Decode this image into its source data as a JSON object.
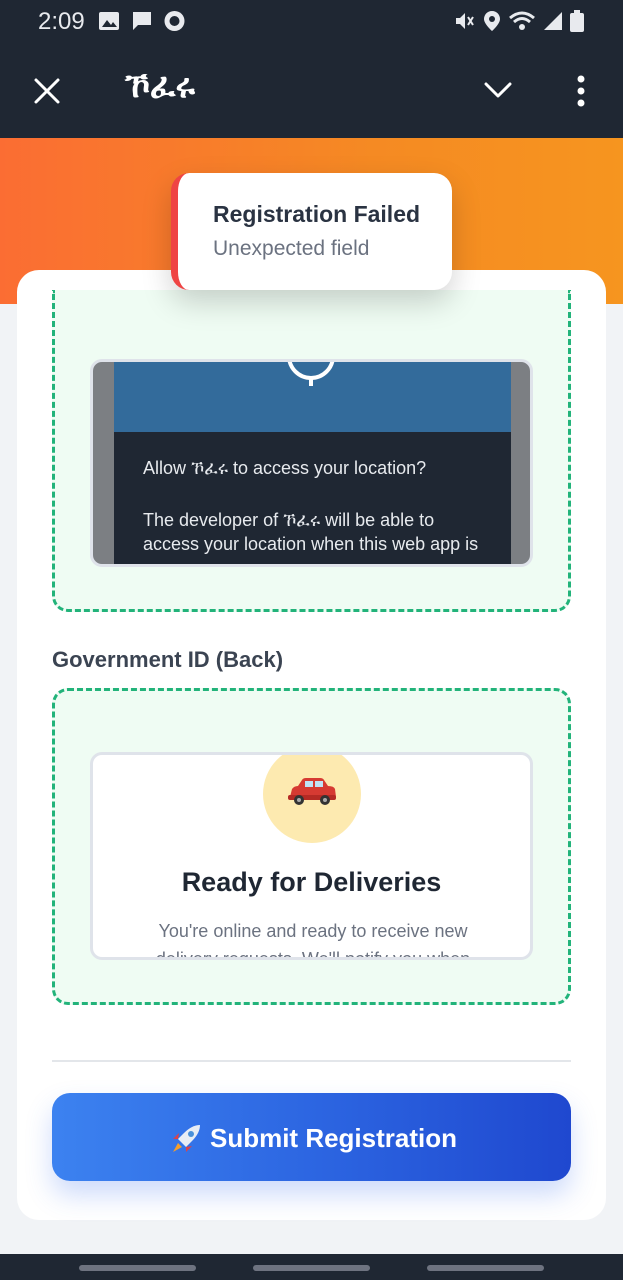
{
  "status_bar": {
    "time": "2:09"
  },
  "app_bar": {
    "title": "ኾፈሩ"
  },
  "toast": {
    "title": "Registration Failed",
    "message": "Unexpected field"
  },
  "front_preview": {
    "line1": "Allow ኾፈሩ to access your location?",
    "line2": "The developer of ኾፈሩ will be able to access your location when this web app is open"
  },
  "back_section": {
    "label": "Government ID (Back)"
  },
  "back_preview": {
    "heading": "Ready for Deliveries",
    "subtext": "You're online and ready to receive new delivery requests. We'll notify you when"
  },
  "submit": {
    "label": "Submit Registration"
  },
  "colors": {
    "accent": "#2b63e0",
    "header": "#1f2733",
    "banner": "#f58a23",
    "error": "#ef4444",
    "dashed": "#22b37a"
  }
}
